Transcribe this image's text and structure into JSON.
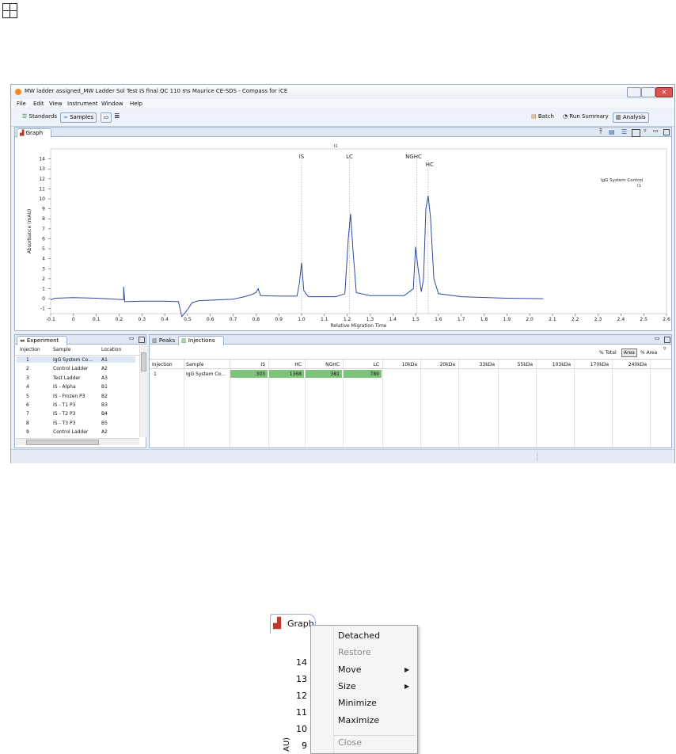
{
  "window": {
    "title": "MW ladder assigned_MW Ladder Sol Test IS final QC 110 ms Maurice CE-SDS - Compass for iCE",
    "menu": [
      "File",
      "Edit",
      "View",
      "Instrument",
      "Window",
      "Help"
    ]
  },
  "toolbar": {
    "standards": "Standards",
    "samples": "Samples",
    "batch": "Batch",
    "run_summary": "Run Summary",
    "analysis": "Analysis"
  },
  "graph_tab": "Graph",
  "chart_data": {
    "type": "line",
    "xlabel": "Relative Migration Time",
    "ylabel": "Absorbance (mAU)",
    "xlim": [
      -0.1,
      2.6
    ],
    "ylim": [
      -1.5,
      15
    ],
    "x_ticks": [
      "-0.1",
      "0",
      "0.1",
      "0.2",
      "0.3",
      "0.4",
      "0.5",
      "0.6",
      "0.7",
      "0.8",
      "0.9",
      "1.0",
      "1.1",
      "1.2",
      "1.3",
      "1.4",
      "1.5",
      "1.6",
      "1.7",
      "1.8",
      "1.9",
      "2.0",
      "2.1",
      "2.2",
      "2.3",
      "2.4",
      "2.5",
      "2.6"
    ],
    "y_ticks": [
      "-1",
      "0",
      "1",
      "2",
      "3",
      "4",
      "5",
      "6",
      "7",
      "8",
      "9",
      "10",
      "11",
      "12",
      "13",
      "14"
    ],
    "top_label": "I1",
    "legend": {
      "label": "IgG System Control",
      "sub": "I1"
    },
    "peak_markers": [
      {
        "label": "IS",
        "x": 1.0
      },
      {
        "label": "LC",
        "x": 1.21
      },
      {
        "label": "NGHC",
        "x": 1.505
      },
      {
        "label": "HC",
        "x": 1.555
      }
    ],
    "series": [
      {
        "name": "I1",
        "points": [
          [
            -0.1,
            -0.1
          ],
          [
            -0.08,
            0.05
          ],
          [
            0.0,
            0.1
          ],
          [
            0.1,
            0.05
          ],
          [
            0.18,
            -0.05
          ],
          [
            0.22,
            -0.1
          ],
          [
            0.22,
            1.2
          ],
          [
            0.225,
            -0.3
          ],
          [
            0.3,
            -0.25
          ],
          [
            0.4,
            -0.25
          ],
          [
            0.46,
            -0.3
          ],
          [
            0.475,
            -1.8
          ],
          [
            0.5,
            -1.1
          ],
          [
            0.52,
            -0.4
          ],
          [
            0.55,
            -0.2
          ],
          [
            0.6,
            -0.15
          ],
          [
            0.7,
            -0.05
          ],
          [
            0.75,
            0.2
          ],
          [
            0.78,
            0.4
          ],
          [
            0.8,
            0.6
          ],
          [
            0.81,
            1.0
          ],
          [
            0.82,
            0.3
          ],
          [
            0.9,
            0.25
          ],
          [
            0.98,
            0.25
          ],
          [
            0.99,
            1.5
          ],
          [
            1.0,
            3.6
          ],
          [
            1.01,
            0.8
          ],
          [
            1.03,
            0.2
          ],
          [
            1.15,
            0.2
          ],
          [
            1.19,
            0.5
          ],
          [
            1.205,
            6.0
          ],
          [
            1.215,
            8.5
          ],
          [
            1.225,
            5.0
          ],
          [
            1.24,
            0.6
          ],
          [
            1.3,
            0.3
          ],
          [
            1.45,
            0.3
          ],
          [
            1.49,
            1.0
          ],
          [
            1.5,
            5.2
          ],
          [
            1.51,
            3.2
          ],
          [
            1.525,
            0.7
          ],
          [
            1.535,
            2.0
          ],
          [
            1.545,
            9.0
          ],
          [
            1.555,
            10.3
          ],
          [
            1.565,
            8.2
          ],
          [
            1.58,
            2.0
          ],
          [
            1.6,
            0.5
          ],
          [
            1.7,
            0.2
          ],
          [
            1.9,
            0.05
          ],
          [
            2.06,
            0.0
          ]
        ]
      }
    ]
  },
  "experiment": {
    "title": "Experiment",
    "headers": [
      "Injection",
      "Sample",
      "Location"
    ],
    "rows": [
      [
        "1",
        "IgG System Co...",
        "A1"
      ],
      [
        "2",
        "Control Ladder",
        "A2"
      ],
      [
        "3",
        "Test Ladder",
        "A3"
      ],
      [
        "4",
        "IS - Alpha",
        "B1"
      ],
      [
        "5",
        "IS - Frozen P3",
        "B2"
      ],
      [
        "6",
        "IS - T1 P3",
        "B3"
      ],
      [
        "7",
        "IS - T2 P3",
        "B4"
      ],
      [
        "8",
        "IS - T3 P3",
        "B5"
      ],
      [
        "9",
        "Control Ladder",
        "A2"
      ]
    ]
  },
  "tabs2": {
    "peaks": "Peaks",
    "injections": "Injections"
  },
  "modes": [
    "% Total",
    "Area",
    "% Area"
  ],
  "injections": {
    "headers": [
      "Injection",
      "Sample",
      "IS",
      "HC",
      "NGHC",
      "LC",
      "10kDa",
      "20kDa",
      "33kDa",
      "55kDa",
      "103kDa",
      "170kDa",
      "240kDa"
    ],
    "rows": [
      [
        "1",
        "IgG System Co...",
        "303",
        "1368",
        "381",
        "789"
      ]
    ]
  },
  "menu": {
    "tab": "Graph",
    "items": [
      {
        "label": "Detached",
        "enabled": true,
        "sub": false
      },
      {
        "label": "Restore",
        "enabled": false,
        "sub": false
      },
      {
        "label": "Move",
        "enabled": true,
        "sub": true
      },
      {
        "label": "Size",
        "enabled": true,
        "sub": true
      },
      {
        "label": "Minimize",
        "enabled": true,
        "sub": false
      },
      {
        "label": "Maximize",
        "enabled": true,
        "sub": false
      },
      {
        "label": "Close",
        "enabled": false,
        "sub": false
      }
    ],
    "axis_ticks": [
      "14",
      "13",
      "12",
      "11",
      "10",
      "9"
    ],
    "axis_label": "AU)"
  }
}
